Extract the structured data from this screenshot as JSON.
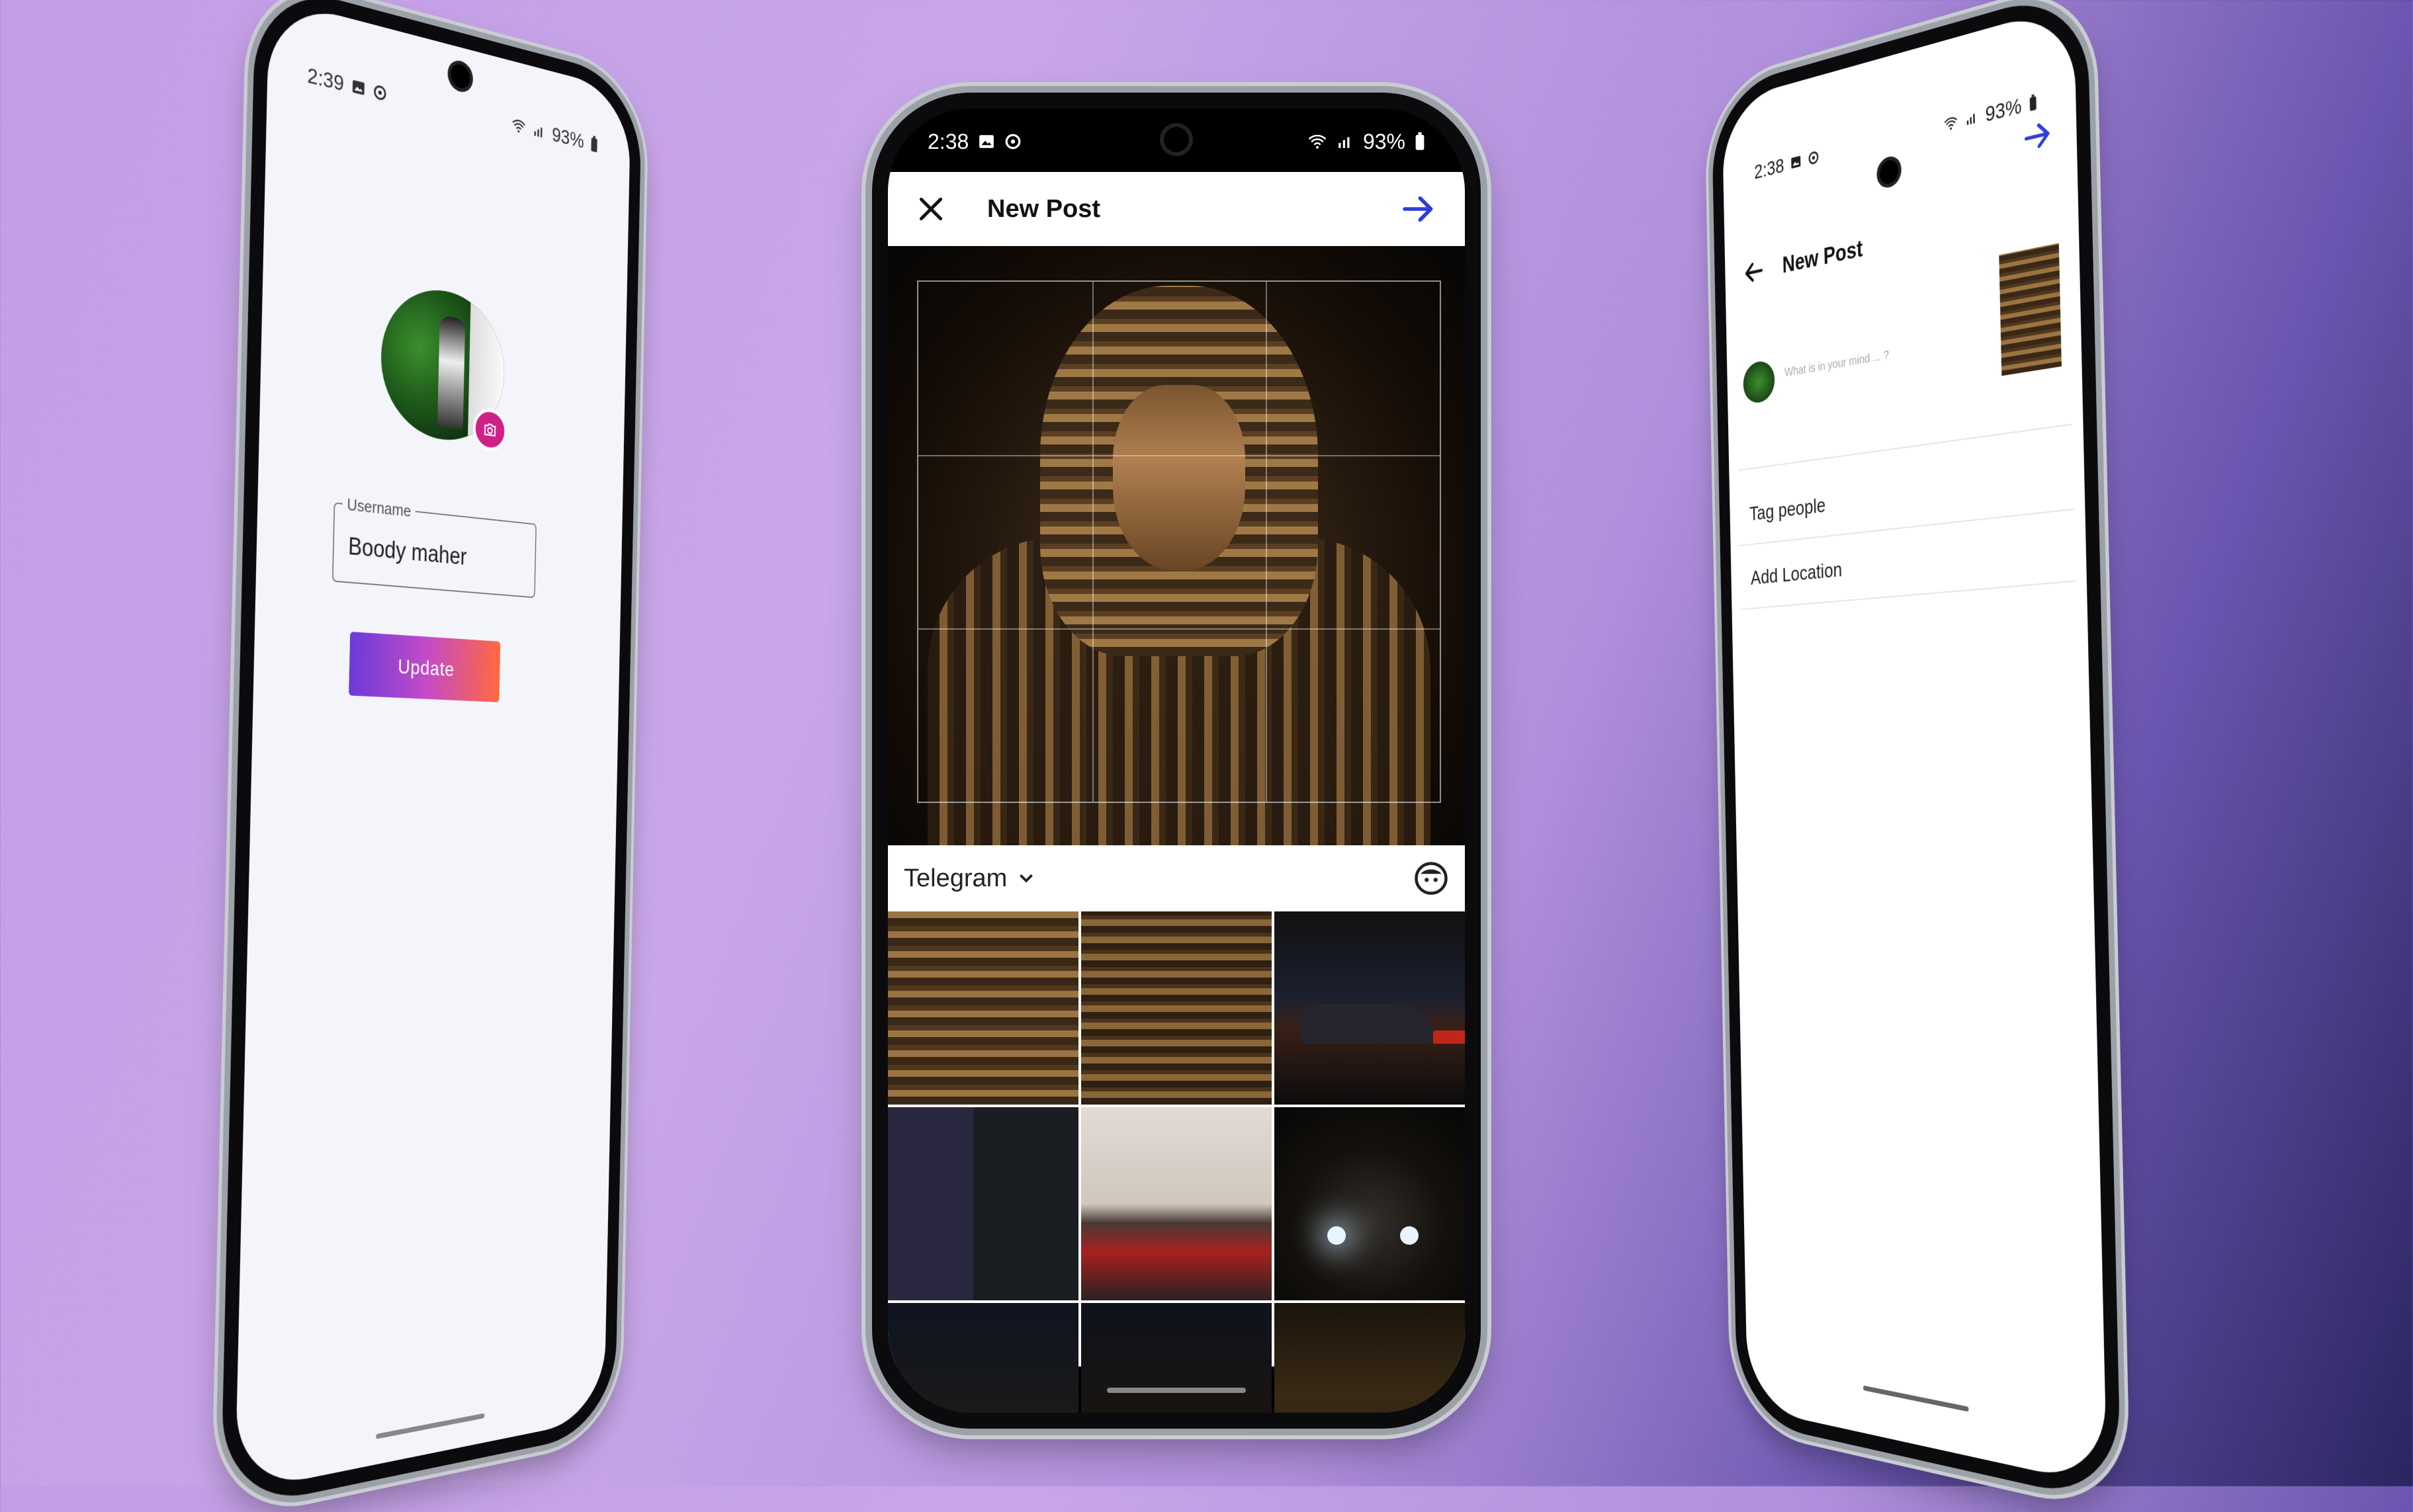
{
  "left_phone": {
    "status": {
      "time": "2:39",
      "battery": "93%"
    },
    "username_label": "Username",
    "username_value": "Boody maher",
    "update_label": "Update"
  },
  "center_phone": {
    "status": {
      "time": "2:38",
      "battery": "93%"
    },
    "header": {
      "title": "New Post"
    },
    "album": {
      "name": "Telegram"
    },
    "gallery_rows": 3,
    "icons": {
      "close": "close-icon",
      "next": "arrow-right-icon",
      "album": "chevron-down-icon",
      "aspect": "face-icon"
    },
    "accent": "#2b3fd6"
  },
  "right_phone": {
    "status": {
      "time": "2:38",
      "battery": "93%"
    },
    "header": {
      "title": "New Post"
    },
    "caption_placeholder": "What is in your mind ... ?",
    "rows": [
      "Tag people",
      "Add Location"
    ],
    "accent": "#2b3fd6"
  }
}
